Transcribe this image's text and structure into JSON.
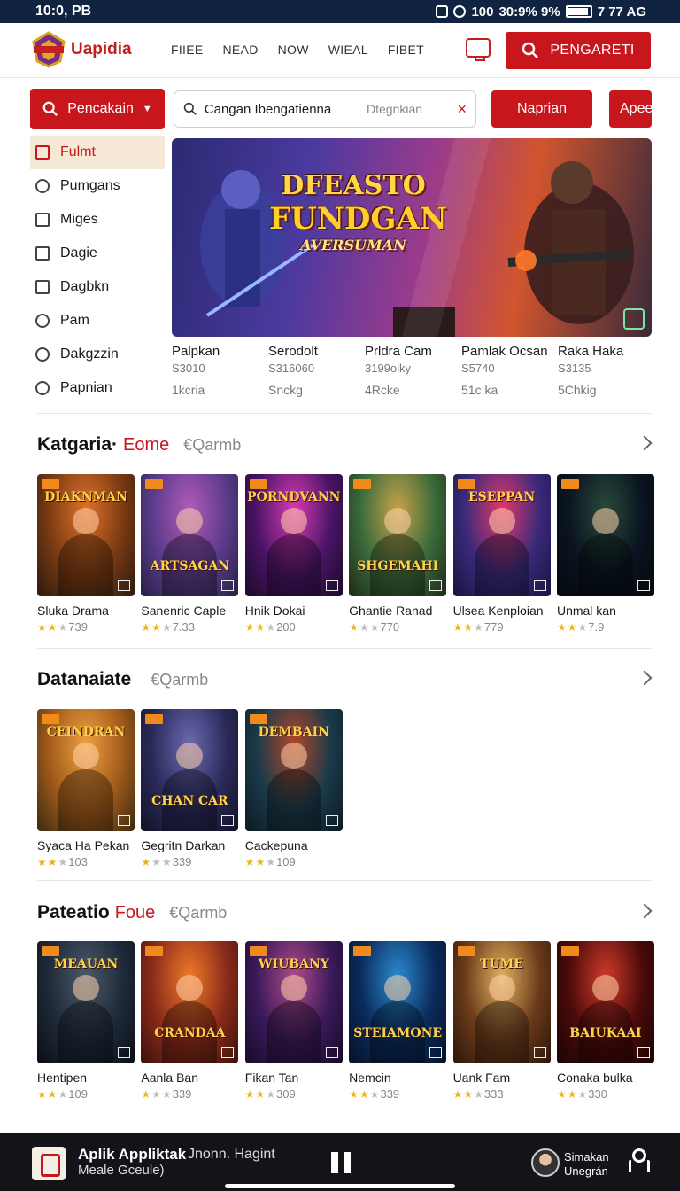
{
  "status_bar": {
    "time": "10:0, PB",
    "right_text": "100",
    "signal_text": "30:9% 9%",
    "battery_text": "7 77 AG"
  },
  "nav": {
    "logo_text": "Uapidia",
    "links": [
      "FIIEE",
      "NEAD",
      "NOW",
      "WIEAL",
      "FIBET"
    ],
    "cta_label": "PENGARETI"
  },
  "search": {
    "category_label": "Pencakain",
    "query": "Cangan Ibengatienna",
    "placeholder": "Dtegnkian",
    "button1": "Naprian",
    "button2": "Apee"
  },
  "sidebar": {
    "items": [
      {
        "label": "Fulmt",
        "icon": "box-icon",
        "active": true
      },
      {
        "label": "Pumgans",
        "icon": "search-icon"
      },
      {
        "label": "Miges",
        "icon": "image-icon"
      },
      {
        "label": "Dagie",
        "icon": "box-icon"
      },
      {
        "label": "Dagbkn",
        "icon": "download-icon"
      },
      {
        "label": "Pam",
        "icon": "search-icon"
      },
      {
        "label": "Dakgzzin",
        "icon": "compass-icon"
      },
      {
        "label": "Papnian",
        "icon": "no-entry-icon"
      }
    ]
  },
  "hero": {
    "title_line1": "DFEASTO",
    "title_line2": "FUNDGAN",
    "title_line3": "AVERSUMAN",
    "stats": [
      {
        "name": "Palpkan",
        "num": "S3010",
        "sub": "1kcria"
      },
      {
        "name": "Serodolt",
        "num": "S316060",
        "sub": "Snckg"
      },
      {
        "name": "Prldra Cam",
        "num": "3199olky",
        "sub": "4Rcke"
      },
      {
        "name": "Pamlak Ocsan",
        "num": "S5740",
        "sub": "51c:ka"
      },
      {
        "name": "Raka Haka",
        "num": "S3135",
        "sub": "5Chkig"
      }
    ]
  },
  "sections": [
    {
      "title": "Katgaria·",
      "accent": "Eome",
      "link": "€Qarmb",
      "items": [
        {
          "name": "Sluka Drama",
          "rating": "739",
          "stars": 2,
          "thumb_title": "DIAKNMAN",
          "colors": [
            "#7a3a12",
            "#e0722a",
            "#2a1a10"
          ]
        },
        {
          "name": "Sanenric Caple",
          "rating": "7.33",
          "stars": 2,
          "thumb_title": "ARTSAGAN",
          "colors": [
            "#5b3b8a",
            "#b15bb7",
            "#262045"
          ]
        },
        {
          "name": "Hnik Dokai",
          "rating": "200",
          "stars": 2,
          "thumb_title": "PORNDVANN",
          "colors": [
            "#4a1466",
            "#d83bb0",
            "#1a0a26"
          ]
        },
        {
          "name": "Ghantie Ranad",
          "rating": "770",
          "stars": 1,
          "thumb_title": "SHGEMAHI",
          "colors": [
            "#3a6a3a",
            "#c7a24a",
            "#1e2a18"
          ]
        },
        {
          "name": "Ulsea Kenploian",
          "rating": "779",
          "stars": 2,
          "thumb_title": "ESEPPAN",
          "colors": [
            "#3a2a7a",
            "#e2386b",
            "#1a1240"
          ]
        },
        {
          "name": "Unmal kan",
          "rating": "7.9",
          "stars": 2,
          "thumb_title": "",
          "colors": [
            "#0a1420",
            "#2a4a3a",
            "#05080c"
          ]
        }
      ]
    },
    {
      "title": "Datanaiate",
      "accent": "",
      "link": "€Qarmb",
      "items": [
        {
          "name": "Syaca Ha Pekan",
          "rating": "103",
          "stars": 2,
          "thumb_title": "CEINDRAN",
          "colors": [
            "#a05a1a",
            "#f0a040",
            "#3a2a10"
          ]
        },
        {
          "name": "Gegritn Darkan",
          "rating": "339",
          "stars": 1,
          "thumb_title": "CHAN CAR",
          "colors": [
            "#2a2a5a",
            "#6a6ab0",
            "#121226"
          ]
        },
        {
          "name": "Cackepuna",
          "rating": "109",
          "stars": 2,
          "thumb_title": "DEMBAIN",
          "colors": [
            "#1a3a4a",
            "#b0462a",
            "#0c1a22"
          ]
        }
      ]
    },
    {
      "title": "Pateatio",
      "accent": "Foue",
      "link": "€Qarmb",
      "items": [
        {
          "name": "Hentipen",
          "rating": "109",
          "stars": 2,
          "thumb_title": "MEAUAN",
          "colors": [
            "#1e2a3a",
            "#4a5a6a",
            "#0a0e14"
          ]
        },
        {
          "name": "Aanla Ban",
          "rating": "339",
          "stars": 1,
          "thumb_title": "CRANDAA",
          "colors": [
            "#8a2a1a",
            "#f07a2a",
            "#3a120a"
          ]
        },
        {
          "name": "Fikan Tan",
          "rating": "309",
          "stars": 2,
          "thumb_title": "WIUBANY",
          "colors": [
            "#3a1a5a",
            "#b04a8a",
            "#160a26"
          ]
        },
        {
          "name": "Nemcin",
          "rating": "339",
          "stars": 2,
          "thumb_title": "STEIAMONE",
          "colors": [
            "#0a2a5a",
            "#2a8ad0",
            "#061228"
          ]
        },
        {
          "name": "Uank Fam",
          "rating": "333",
          "stars": 2,
          "thumb_title": "TUME",
          "colors": [
            "#6a3a1a",
            "#e0b060",
            "#2a1608"
          ]
        },
        {
          "name": "Conaka bulka",
          "rating": "330",
          "stars": 2,
          "thumb_title": "BAIUKAAI",
          "colors": [
            "#4a0a0a",
            "#d03a2a",
            "#1a0404"
          ]
        }
      ]
    }
  ],
  "bottom_bar": {
    "app_title": "Aplik Appliktak",
    "app_title2": "Jnonn. Hagint",
    "app_sub": "Meale Gceule)",
    "user_line1": "Simakan",
    "user_line2": "Unegrán"
  }
}
